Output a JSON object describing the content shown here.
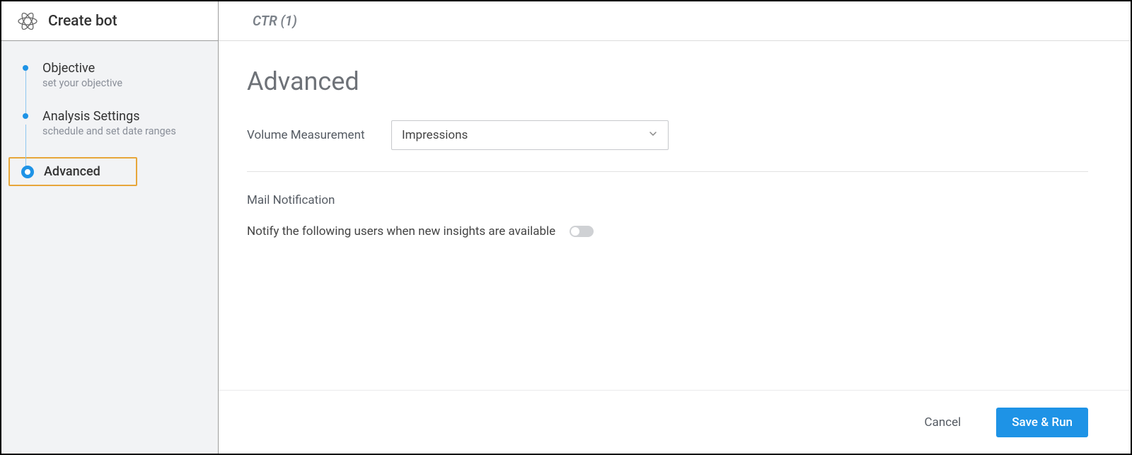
{
  "sidebar": {
    "title": "Create bot",
    "steps": [
      {
        "title": "Objective",
        "sub": "set your objective"
      },
      {
        "title": "Analysis Settings",
        "sub": "schedule and set date ranges"
      },
      {
        "title": "Advanced",
        "sub": ""
      }
    ]
  },
  "header": {
    "breadcrumb": "CTR (1)"
  },
  "page": {
    "heading": "Advanced",
    "volume_label": "Volume Measurement",
    "volume_value": "Impressions",
    "mail_section_label": "Mail Notification",
    "notify_text": "Notify the following users when new insights are available"
  },
  "footer": {
    "cancel": "Cancel",
    "save": "Save & Run"
  }
}
